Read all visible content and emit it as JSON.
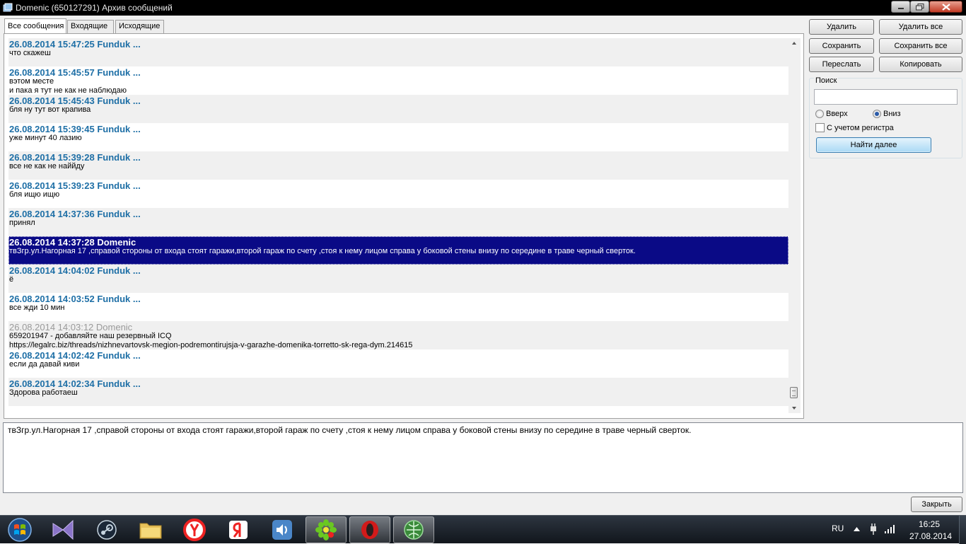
{
  "window": {
    "title": "Domenic (650127291) Архив сообщений",
    "controls": [
      "minimize",
      "maximize",
      "close"
    ]
  },
  "tabs": [
    {
      "label": "Все сообщения",
      "active": true
    },
    {
      "label": "Входящие",
      "active": false
    },
    {
      "label": "Исходящие",
      "active": false
    }
  ],
  "messages": [
    {
      "header": "26.08.2014 15:47:25 Funduk ...",
      "lines": [
        "что скажеш"
      ],
      "alt": true
    },
    {
      "header": "26.08.2014 15:45:57 Funduk ...",
      "lines": [
        "вэтом месте",
        "и пака я тут не как не наблюдаю"
      ],
      "alt": false
    },
    {
      "header": "26.08.2014 15:45:43 Funduk ...",
      "lines": [
        "бля ну тут вот крапива"
      ],
      "alt": true
    },
    {
      "header": "26.08.2014 15:39:45 Funduk ...",
      "lines": [
        "уже минут 40 лазию"
      ],
      "alt": false
    },
    {
      "header": "26.08.2014 15:39:28 Funduk ...",
      "lines": [
        "все не как не наййду"
      ],
      "alt": true
    },
    {
      "header": "26.08.2014 15:39:23 Funduk ...",
      "lines": [
        "бля ищю ищю"
      ],
      "alt": false
    },
    {
      "header": "26.08.2014 14:37:36 Funduk ...",
      "lines": [
        "принял"
      ],
      "alt": true
    },
    {
      "header": "26.08.2014 14:37:28 Domenic",
      "lines": [
        "твЗгр.ул.Нагорная 17 ,справой стороны от входа стоят гаражи,второй гараж по счету ,стоя к нему лицом справа у боковой стены внизу по середине в траве черный сверток."
      ],
      "selected": true
    },
    {
      "header": "26.08.2014 14:04:02 Funduk ...",
      "lines": [
        "ё"
      ],
      "alt": true
    },
    {
      "header": "26.08.2014 14:03:52 Funduk ...",
      "lines": [
        "все жди 10 мин"
      ],
      "alt": false
    },
    {
      "header": "26.08.2014 14:03:12 Domenic",
      "lines": [
        "659201947 - добавляйте наш резервный ICQ",
        "https://legalrc.biz/threads/nizhnevartovsk-megion-podremontirujsja-v-garazhe-domenika-torretto-sk-rega-dym.214615"
      ],
      "alt": true,
      "gray": true
    },
    {
      "header": "26.08.2014 14:02:42 Funduk ...",
      "lines": [
        "если да давай киви"
      ],
      "alt": false
    },
    {
      "header": "26.08.2014 14:02:34 Funduk ...",
      "lines": [
        "Здорова работаеш"
      ],
      "alt": true
    }
  ],
  "actions": {
    "delete": "Удалить",
    "delete_all": "Удалить все",
    "save": "Сохранить",
    "save_all": "Сохранить все",
    "forward": "Переслать",
    "copy": "Копировать"
  },
  "search": {
    "group_label": "Поиск",
    "value": "",
    "dir_up": "Вверх",
    "dir_down": "Вниз",
    "direction": "down",
    "case_label": "С учетом регистра",
    "case_checked": false,
    "find_next": "Найти далее"
  },
  "compose": {
    "text": "твЗгр.ул.Нагорная 17 ,справой стороны от входа стоят гаражи,второй гараж по счету ,стоя к нему лицом справа у боковой стены внизу по середине в траве черный сверток."
  },
  "close_button": "Закрыть",
  "taskbar": {
    "items": [
      "start-orb",
      "visual-studio-icon",
      "steam-icon",
      "file-explorer-icon",
      "yandex-browser-icon",
      "yandex-icon",
      "volume-app-icon",
      "icq-icon",
      "opera-icon",
      "network-app-icon"
    ],
    "active": [
      "icq-icon",
      "opera-icon",
      "network-app-icon"
    ],
    "language": "RU",
    "time": "16:25",
    "date": "27.08.2014"
  }
}
